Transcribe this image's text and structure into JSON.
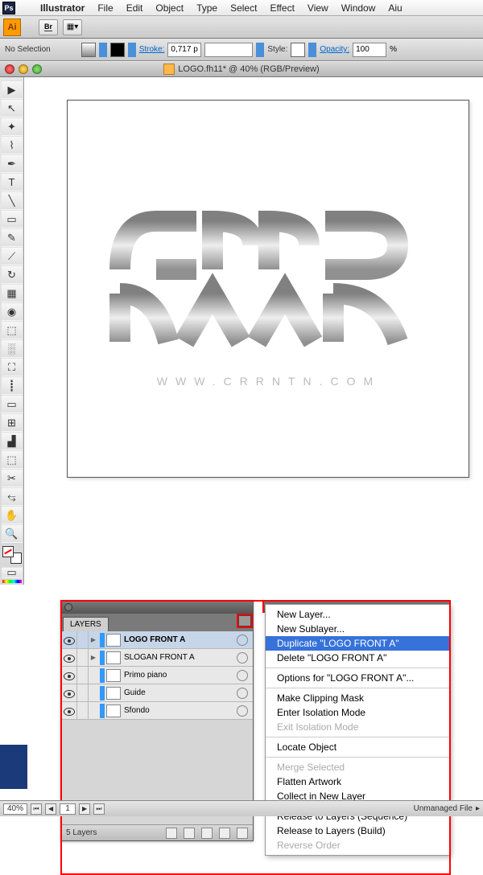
{
  "menubar": {
    "app": "Illustrator",
    "items": [
      "File",
      "Edit",
      "Object",
      "Type",
      "Select",
      "Effect",
      "View",
      "Window",
      "Aiu"
    ]
  },
  "appbar": {
    "ai": "Ai",
    "br": "Br"
  },
  "optbar": {
    "selection": "No Selection",
    "stroke_label": "Stroke:",
    "stroke_value": "0,717 p",
    "style_label": "Style:",
    "opacity_label": "Opacity:",
    "opacity_value": "100",
    "opacity_unit": "%"
  },
  "doc": {
    "title": "LOGO.fh11* @ 40% (RGB/Preview)"
  },
  "artwork": {
    "url_text": "WWW.CRRNTN.COM"
  },
  "tools": [
    "▶",
    "↖",
    "✦",
    "⌇",
    "✒",
    "T",
    "╲",
    "▭",
    "✎",
    "⟋",
    "↻",
    "▦",
    "◉",
    "⬚",
    "░",
    "⛶",
    "┋",
    "▭",
    "⊞",
    "▟",
    "⬚",
    "✂",
    "⥃",
    "✋",
    "🔍"
  ],
  "layers_panel": {
    "title": "LAYERS",
    "items": [
      {
        "name": "LOGO FRONT A",
        "selected": true
      },
      {
        "name": "SLOGAN FRONT A",
        "selected": false
      },
      {
        "name": "Primo piano",
        "selected": false
      },
      {
        "name": "Guide",
        "selected": false
      },
      {
        "name": "Sfondo",
        "selected": false
      }
    ],
    "footer": "5 Layers"
  },
  "context_menu": {
    "items": [
      {
        "label": "New Layer...",
        "type": "normal"
      },
      {
        "label": "New Sublayer...",
        "type": "normal"
      },
      {
        "label": "Duplicate \"LOGO FRONT A\"",
        "type": "selected"
      },
      {
        "label": "Delete \"LOGO FRONT A\"",
        "type": "normal"
      },
      {
        "type": "sep"
      },
      {
        "label": "Options for \"LOGO FRONT A\"...",
        "type": "normal"
      },
      {
        "type": "sep"
      },
      {
        "label": "Make Clipping Mask",
        "type": "normal"
      },
      {
        "label": "Enter Isolation Mode",
        "type": "normal"
      },
      {
        "label": "Exit Isolation Mode",
        "type": "disabled"
      },
      {
        "type": "sep"
      },
      {
        "label": "Locate Object",
        "type": "normal"
      },
      {
        "type": "sep"
      },
      {
        "label": "Merge Selected",
        "type": "disabled"
      },
      {
        "label": "Flatten Artwork",
        "type": "normal"
      },
      {
        "label": "Collect in New Layer",
        "type": "normal"
      },
      {
        "type": "sep"
      },
      {
        "label": "Release to Layers (Sequence)",
        "type": "normal"
      },
      {
        "label": "Release to Layers (Build)",
        "type": "normal"
      },
      {
        "label": "Reverse Order",
        "type": "disabled"
      }
    ]
  },
  "statusbar": {
    "zoom": "40%",
    "page": "1",
    "status": "Unmanaged File"
  }
}
